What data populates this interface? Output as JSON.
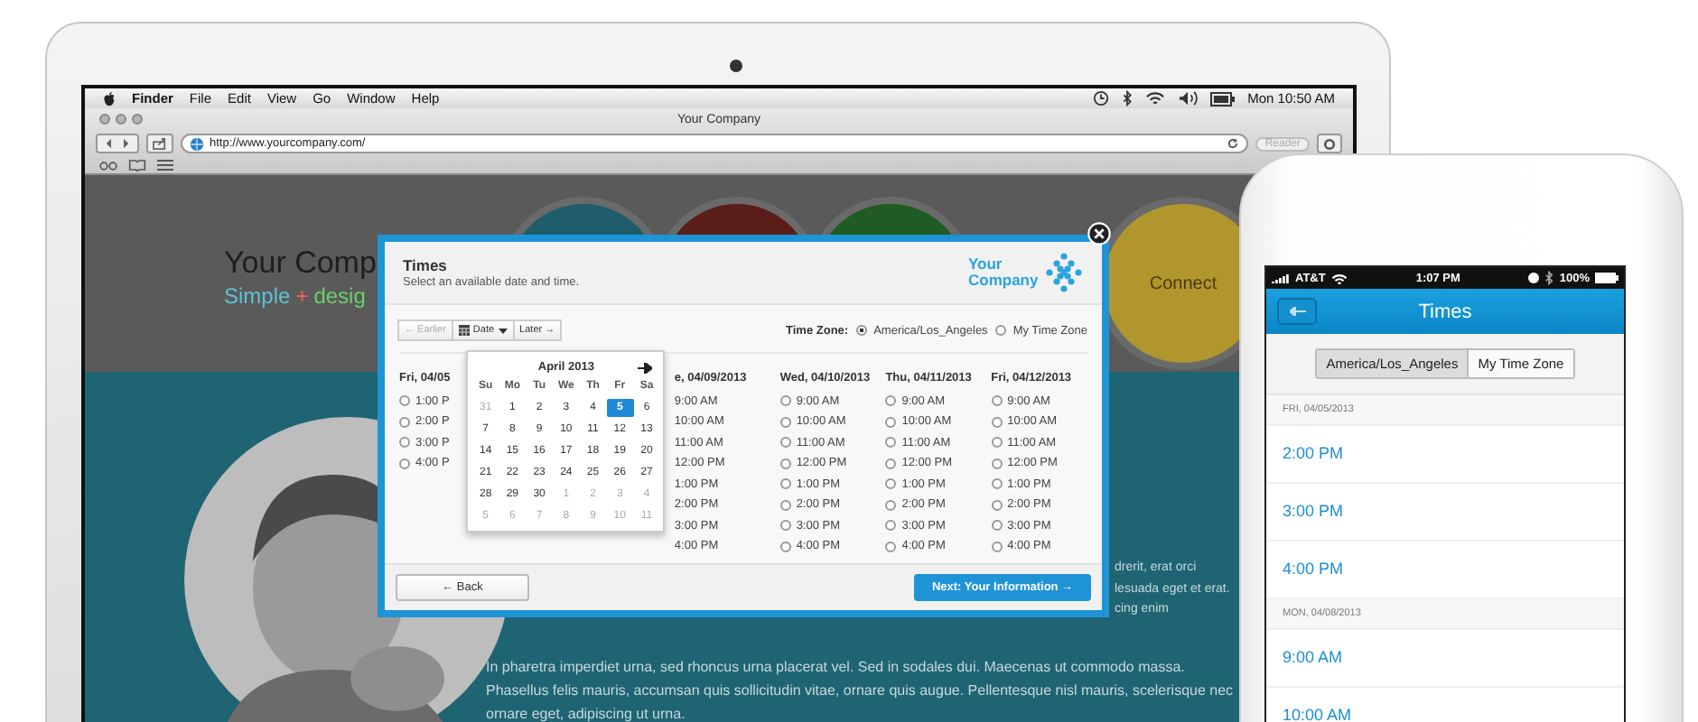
{
  "laptop": {
    "menubar": {
      "items": [
        "Finder",
        "File",
        "Edit",
        "View",
        "Go",
        "Window",
        "Help"
      ],
      "clock": "Mon 10:50 AM"
    },
    "browser": {
      "title": "Your Company",
      "url": "http://www.yourcompany.com/",
      "reader": "Reader"
    },
    "page": {
      "heading": "Your Comp",
      "tagline": [
        {
          "text": "Simple",
          "color": "#5cc4d0"
        },
        {
          "text": "+",
          "color": "#ff5a5a"
        },
        {
          "text": "desig",
          "color": "#6ad06a"
        }
      ],
      "circles": [
        {
          "color": "#1f5d6b"
        },
        {
          "color": "#5a1d18"
        },
        {
          "color": "#1f5b22"
        },
        {
          "color": "#b0962c",
          "label": "Connect"
        }
      ],
      "side_text": [
        "drerit, erat orci",
        "lesuada eget et erat.",
        "cing enim"
      ],
      "paragraph": "In pharetra imperdiet urna, sed rhoncus urna placerat vel. Sed in sodales dui. Maecenas ut commodo massa. Phasellus felis mauris, accumsan quis sollicitudin vitae, ornare quis augue. Pellentesque nisl mauris, scelerisque nec ornare eget, adipiscing ut urna."
    },
    "modal": {
      "title": "Times",
      "subtitle": "Select an available date and time.",
      "logo": "Your Company",
      "nav": [
        {
          "label": "← Earlier",
          "disabled": true,
          "kind": "text"
        },
        {
          "label": "Date",
          "disabled": false,
          "kind": "date"
        },
        {
          "label": "Later →",
          "disabled": false,
          "kind": "text"
        }
      ],
      "timezone": {
        "label": "Time Zone:",
        "options": [
          {
            "label": "America/Los_Angeles",
            "selected": true
          },
          {
            "label": "My Time Zone",
            "selected": false
          }
        ]
      },
      "columns": [
        {
          "header": "Fri, 04/05",
          "kind": "full",
          "times": [
            "1:00 P",
            "2:00 P",
            "3:00 P",
            "4:00 P"
          ]
        },
        {
          "header": "e, 04/09/2013",
          "kind": "cut",
          "times": [
            "9:00 AM",
            "10:00 AM",
            "11:00 AM",
            "12:00 PM",
            "1:00 PM",
            "2:00 PM",
            "3:00 PM",
            "4:00 PM"
          ]
        },
        {
          "header": "Wed, 04/10/2013",
          "kind": "full",
          "times": [
            "9:00 AM",
            "10:00 AM",
            "11:00 AM",
            "12:00 PM",
            "1:00 PM",
            "2:00 PM",
            "3:00 PM",
            "4:00 PM"
          ]
        },
        {
          "header": "Thu, 04/11/2013",
          "kind": "full",
          "times": [
            "9:00 AM",
            "10:00 AM",
            "11:00 AM",
            "12:00 PM",
            "1:00 PM",
            "2:00 PM",
            "3:00 PM",
            "4:00 PM"
          ]
        },
        {
          "header": "Fri, 04/12/2013",
          "kind": "full",
          "times": [
            "9:00 AM",
            "10:00 AM",
            "11:00 AM",
            "12:00 PM",
            "1:00 PM",
            "2:00 PM",
            "3:00 PM",
            "4:00 PM"
          ]
        }
      ],
      "calendar": {
        "month": "April 2013",
        "weekdays": [
          "Su",
          "Mo",
          "Tu",
          "We",
          "Th",
          "Fr",
          "Sa"
        ],
        "days": [
          {
            "d": "31",
            "muted": true,
            "selected": false
          },
          {
            "d": "1",
            "muted": false,
            "selected": false
          },
          {
            "d": "2",
            "muted": false,
            "selected": false
          },
          {
            "d": "3",
            "muted": false,
            "selected": false
          },
          {
            "d": "4",
            "muted": false,
            "selected": false
          },
          {
            "d": "5",
            "muted": false,
            "selected": true
          },
          {
            "d": "6",
            "muted": false,
            "selected": false
          },
          {
            "d": "7",
            "muted": false,
            "selected": false
          },
          {
            "d": "8",
            "muted": false,
            "selected": false
          },
          {
            "d": "9",
            "muted": false,
            "selected": false
          },
          {
            "d": "10",
            "muted": false,
            "selected": false
          },
          {
            "d": "11",
            "muted": false,
            "selected": false
          },
          {
            "d": "12",
            "muted": false,
            "selected": false
          },
          {
            "d": "13",
            "muted": false,
            "selected": false
          },
          {
            "d": "14",
            "muted": false,
            "selected": false
          },
          {
            "d": "15",
            "muted": false,
            "selected": false
          },
          {
            "d": "16",
            "muted": false,
            "selected": false
          },
          {
            "d": "17",
            "muted": false,
            "selected": false
          },
          {
            "d": "18",
            "muted": false,
            "selected": false
          },
          {
            "d": "19",
            "muted": false,
            "selected": false
          },
          {
            "d": "20",
            "muted": false,
            "selected": false
          },
          {
            "d": "21",
            "muted": false,
            "selected": false
          },
          {
            "d": "22",
            "muted": false,
            "selected": false
          },
          {
            "d": "23",
            "muted": false,
            "selected": false
          },
          {
            "d": "24",
            "muted": false,
            "selected": false
          },
          {
            "d": "25",
            "muted": false,
            "selected": false
          },
          {
            "d": "26",
            "muted": false,
            "selected": false
          },
          {
            "d": "27",
            "muted": false,
            "selected": false
          },
          {
            "d": "28",
            "muted": false,
            "selected": false
          },
          {
            "d": "29",
            "muted": false,
            "selected": false
          },
          {
            "d": "30",
            "muted": false,
            "selected": false
          },
          {
            "d": "1",
            "muted": true,
            "selected": false
          },
          {
            "d": "2",
            "muted": true,
            "selected": false
          },
          {
            "d": "3",
            "muted": true,
            "selected": false
          },
          {
            "d": "4",
            "muted": true,
            "selected": false
          },
          {
            "d": "5",
            "muted": true,
            "selected": false
          },
          {
            "d": "6",
            "muted": true,
            "selected": false
          },
          {
            "d": "7",
            "muted": true,
            "selected": false
          },
          {
            "d": "8",
            "muted": true,
            "selected": false
          },
          {
            "d": "9",
            "muted": true,
            "selected": false
          },
          {
            "d": "10",
            "muted": true,
            "selected": false
          },
          {
            "d": "11",
            "muted": true,
            "selected": false
          }
        ]
      },
      "back": "← Back",
      "next": "Next: Your Information →"
    }
  },
  "phone": {
    "carrier": "AT&T",
    "time": "1:07 PM",
    "battery": "100%",
    "title": "Times",
    "segments": [
      {
        "label": "America/Los_Angeles",
        "selected": true
      },
      {
        "label": "My Time Zone",
        "selected": false
      }
    ],
    "list": [
      {
        "kind": "section",
        "text": "FRI, 04/05/2013"
      },
      {
        "kind": "time",
        "text": "2:00 PM"
      },
      {
        "kind": "time",
        "text": "3:00 PM"
      },
      {
        "kind": "time",
        "text": "4:00 PM"
      },
      {
        "kind": "section",
        "text": "MON, 04/08/2013"
      },
      {
        "kind": "time",
        "text": "9:00 AM"
      },
      {
        "kind": "time",
        "text": "10:00 AM"
      }
    ]
  }
}
